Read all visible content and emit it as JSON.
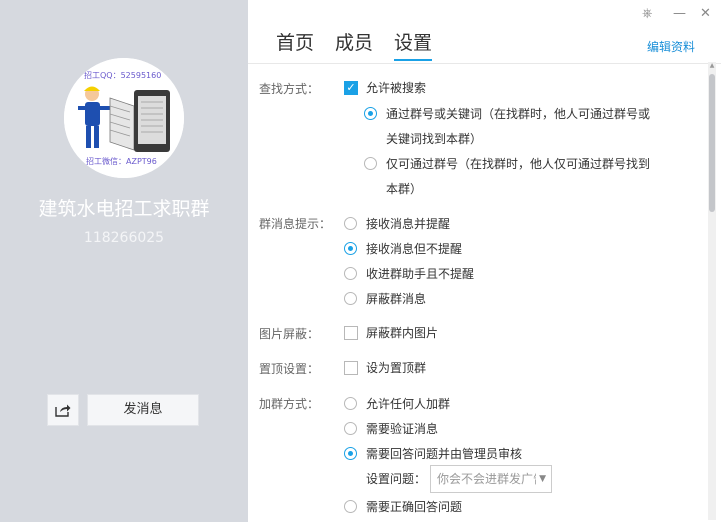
{
  "sidebar": {
    "group_name": "建筑水电招工求职群",
    "group_id": "118266025",
    "avatar_text_top": "招工QQ：52595160",
    "avatar_text_bottom": "招工微信：AZPT96",
    "send_label": "发消息"
  },
  "window": {
    "skin": "⎈",
    "minimize": "—",
    "close": "✕"
  },
  "tabs": [
    {
      "label": "首页"
    },
    {
      "label": "成员"
    },
    {
      "label": "设置"
    }
  ],
  "edit_link": "编辑资料",
  "settings": {
    "search": {
      "label": "查找方式：",
      "allow": "允许被搜索",
      "opt1_line1": "通过群号或关键词（在找群时，他人可通过群号或",
      "opt1_line2": "关键词找到本群）",
      "opt2_line1": "仅可通过群号（在找群时，他人仅可通过群号找到",
      "opt2_line2": "本群）"
    },
    "notify": {
      "label": "群消息提示：",
      "options": [
        "接收消息并提醒",
        "接收消息但不提醒",
        "收进群助手且不提醒",
        "屏蔽群消息"
      ]
    },
    "image": {
      "label": "图片屏蔽：",
      "option": "屏蔽群内图片"
    },
    "pin": {
      "label": "置顶设置：",
      "option": "设为置顶群"
    },
    "join": {
      "label": "加群方式：",
      "options": [
        "允许任何人加群",
        "需要验证消息",
        "需要回答问题并由管理员审核"
      ],
      "question_label": "设置问题：",
      "question_value": "你会不会进群发广告",
      "last_option": "需要正确回答问题"
    }
  },
  "colors": {
    "accent": "#1aa1e6",
    "sidebar_bg": "#d6d9df"
  }
}
